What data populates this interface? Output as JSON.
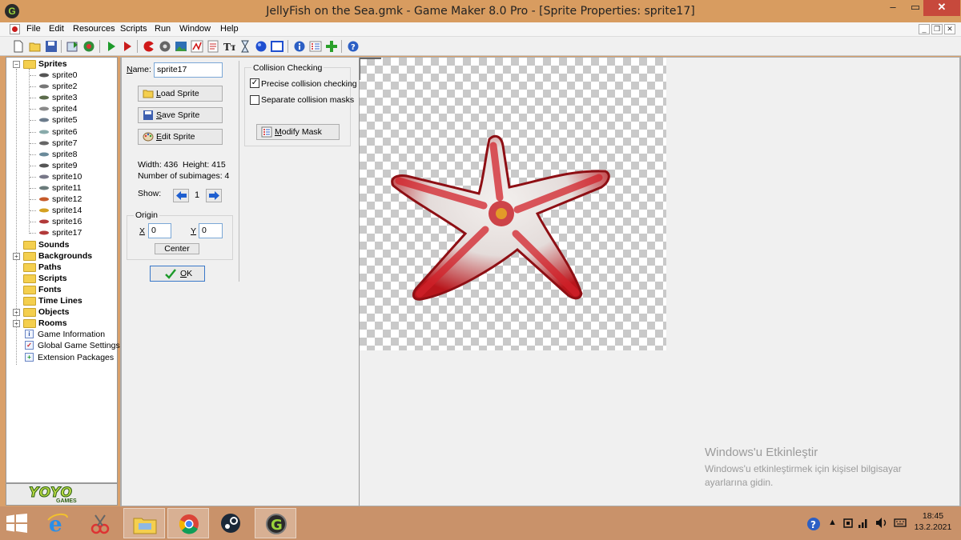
{
  "window": {
    "title": "JellyFish on the Sea.gmk - Game Maker 8.0 Pro - [Sprite Properties: sprite17]",
    "min_label": "‒",
    "max_label": "▭",
    "close_label": "✕"
  },
  "menu": [
    "File",
    "Edit",
    "Resources",
    "Scripts",
    "Run",
    "Window",
    "Help"
  ],
  "mdi_controls": [
    "_",
    "❐",
    "✕"
  ],
  "toolbar_icons": [
    "new-file-icon",
    "open-folder-icon",
    "save-icon",
    "create-executable-icon",
    "publish-icon",
    "run-icon",
    "run-debug-icon",
    "add-sprite-icon",
    "add-sound-icon",
    "add-background-icon",
    "add-path-icon",
    "add-script-icon",
    "add-font-icon",
    "add-timeline-icon",
    "add-object-icon",
    "add-room-icon",
    "game-information-icon",
    "global-settings-icon",
    "extension-packages-icon",
    "help-icon"
  ],
  "tree": {
    "sprites_label": "Sprites",
    "sprites": [
      "sprite0",
      "sprite2",
      "sprite3",
      "sprite4",
      "sprite5",
      "sprite6",
      "sprite7",
      "sprite8",
      "sprite9",
      "sprite10",
      "sprite11",
      "sprite12",
      "sprite14",
      "sprite16",
      "sprite17"
    ],
    "folders": [
      {
        "label": "Sounds",
        "expandable": false
      },
      {
        "label": "Backgrounds",
        "expandable": true
      },
      {
        "label": "Paths",
        "expandable": false
      },
      {
        "label": "Scripts",
        "expandable": false
      },
      {
        "label": "Fonts",
        "expandable": false
      },
      {
        "label": "Time Lines",
        "expandable": false
      },
      {
        "label": "Objects",
        "expandable": true
      },
      {
        "label": "Rooms",
        "expandable": true
      }
    ],
    "extras": [
      {
        "label": "Game Information",
        "icon": "info-icon"
      },
      {
        "label": "Global Game Settings",
        "icon": "checklist-icon"
      },
      {
        "label": "Extension Packages",
        "icon": "plus-icon"
      }
    ]
  },
  "brand": {
    "logo": "YOYO",
    "sub": "GAMES"
  },
  "sprite": {
    "name_label_u": "N",
    "name_label_rest": "ame:",
    "name_value": "sprite17",
    "load_u": "L",
    "load_rest": "oad Sprite",
    "save_u": "S",
    "save_rest": "ave Sprite",
    "edit_u": "E",
    "edit_rest": "dit Sprite",
    "width_text": "Width: 436",
    "height_text": "Height: 415",
    "subimages_text": "Number of subimages: 4",
    "show_label": "Show:",
    "show_value": "1",
    "origin_title": "Origin",
    "x_label": "X",
    "x_value": "0",
    "y_label": "Y",
    "y_value": "0",
    "center_label": "Center",
    "ok_u": "O",
    "ok_rest": "K"
  },
  "collision": {
    "title": "Collision Checking",
    "precise_label": "Precise collision checking",
    "precise_checked": true,
    "separate_label": "Separate collision masks",
    "separate_checked": false,
    "modify_u": "M",
    "modify_rest": "odify Mask"
  },
  "activation": {
    "title": "Windows'u Etkinleştir",
    "line1": "Windows'u etkinleştirmek için kişisel bilgisayar",
    "line2": "ayarlarına gidin."
  },
  "taskbar": {
    "apps": [
      "start-button",
      "internet-explorer-icon",
      "snipping-tool-icon",
      "file-explorer-icon",
      "chrome-icon",
      "steam-icon",
      "game-maker-icon"
    ],
    "time": "18:45",
    "date": "13.2.2021"
  }
}
